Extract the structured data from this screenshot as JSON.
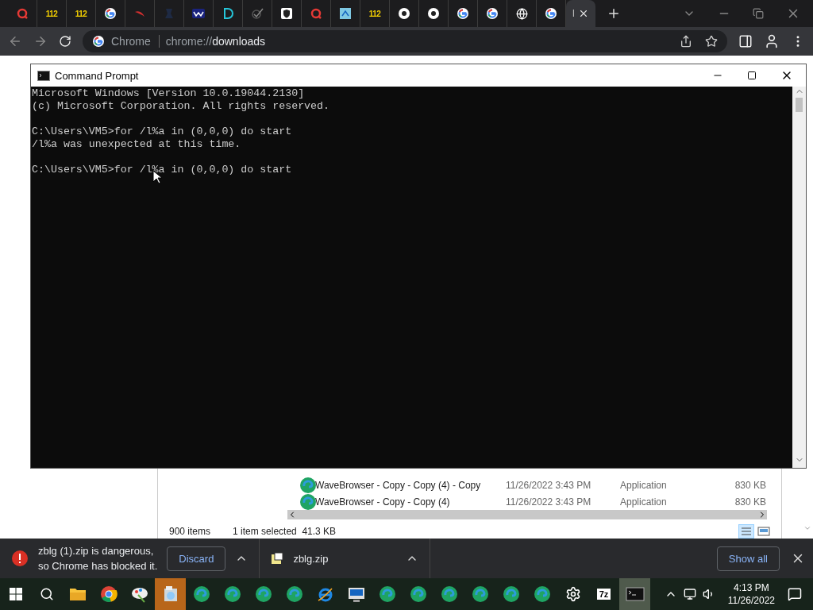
{
  "browser": {
    "tabs": [
      {
        "kind": "q",
        "selected": false
      },
      {
        "kind": "number",
        "label": "112",
        "selected": false
      },
      {
        "kind": "number",
        "label": "112",
        "selected": false
      },
      {
        "kind": "google",
        "selected": false
      },
      {
        "kind": "swoosh",
        "selected": false
      },
      {
        "kind": "dark",
        "selected": false
      },
      {
        "kind": "wave",
        "selected": false
      },
      {
        "kind": "d-logo",
        "selected": false
      },
      {
        "kind": "check",
        "selected": false
      },
      {
        "kind": "shield",
        "selected": false
      },
      {
        "kind": "q",
        "selected": false
      },
      {
        "kind": "tile",
        "selected": false
      },
      {
        "kind": "number",
        "label": "112",
        "selected": false
      },
      {
        "kind": "chrome",
        "selected": false
      },
      {
        "kind": "chrome",
        "selected": false
      },
      {
        "kind": "google",
        "selected": false
      },
      {
        "kind": "google",
        "selected": false
      },
      {
        "kind": "globe",
        "selected": false
      },
      {
        "kind": "google",
        "selected": false
      },
      {
        "kind": "text",
        "title": "I",
        "selected": true
      }
    ],
    "address": {
      "chip": "Chrome",
      "scheme": "chrome://",
      "path": "downloads"
    }
  },
  "explorer": {
    "rows": [
      {
        "name": "WaveBrowser - Copy - Copy (4) - Copy",
        "date": "11/26/2022 3:43 PM",
        "type": "Application",
        "size": "830 KB"
      },
      {
        "name": "WaveBrowser - Copy - Copy (4)",
        "date": "11/26/2022 3:43 PM",
        "type": "Application",
        "size": "830 KB"
      }
    ],
    "status": {
      "count": "900 items",
      "selection": "1 item selected  41.3 KB"
    }
  },
  "console": {
    "title": "Command Prompt",
    "blocks": [
      {
        "lines": [
          "Microsoft Windows [Version 10.0.19044.2130]",
          "(c) Microsoft Corporation. All rights reserved."
        ]
      },
      {
        "lines": [
          "C:\\Users\\VM5>for /l%a in (0,0,0) do start",
          "/l%a was unexpected at this time."
        ]
      },
      {
        "lines": [
          "C:\\Users\\VM5>for /l%a in (0,0,0) do start"
        ]
      }
    ]
  },
  "downloads": {
    "items": [
      {
        "kind": "blocked",
        "message": "zblg (1).zip is dangerous,\nso Chrome has blocked it.",
        "action": "Discard"
      },
      {
        "kind": "file",
        "name": "zblg.zip"
      }
    ],
    "show_all": "Show all"
  },
  "taskbar": {
    "apps": [
      {
        "kind": "folder",
        "selected": false
      },
      {
        "kind": "chrome",
        "selected": false
      },
      {
        "kind": "paint",
        "selected": false
      },
      {
        "kind": "installer",
        "selected": true
      },
      {
        "kind": "edge",
        "selected": false
      },
      {
        "kind": "edge",
        "selected": false
      },
      {
        "kind": "edge",
        "selected": false
      },
      {
        "kind": "edge",
        "selected": false
      },
      {
        "kind": "ie",
        "selected": false
      },
      {
        "kind": "monitor",
        "selected": false
      },
      {
        "kind": "edge",
        "selected": false
      },
      {
        "kind": "edge",
        "selected": false
      },
      {
        "kind": "edge",
        "selected": false
      },
      {
        "kind": "edge",
        "selected": false
      },
      {
        "kind": "edge",
        "selected": false
      },
      {
        "kind": "edge",
        "selected": false
      },
      {
        "kind": "settings",
        "selected": false
      },
      {
        "kind": "archive",
        "label": "7z",
        "selected": false
      },
      {
        "kind": "terminal",
        "selected": true
      }
    ],
    "time": "4:13 PM",
    "date": "11/26/2022"
  }
}
